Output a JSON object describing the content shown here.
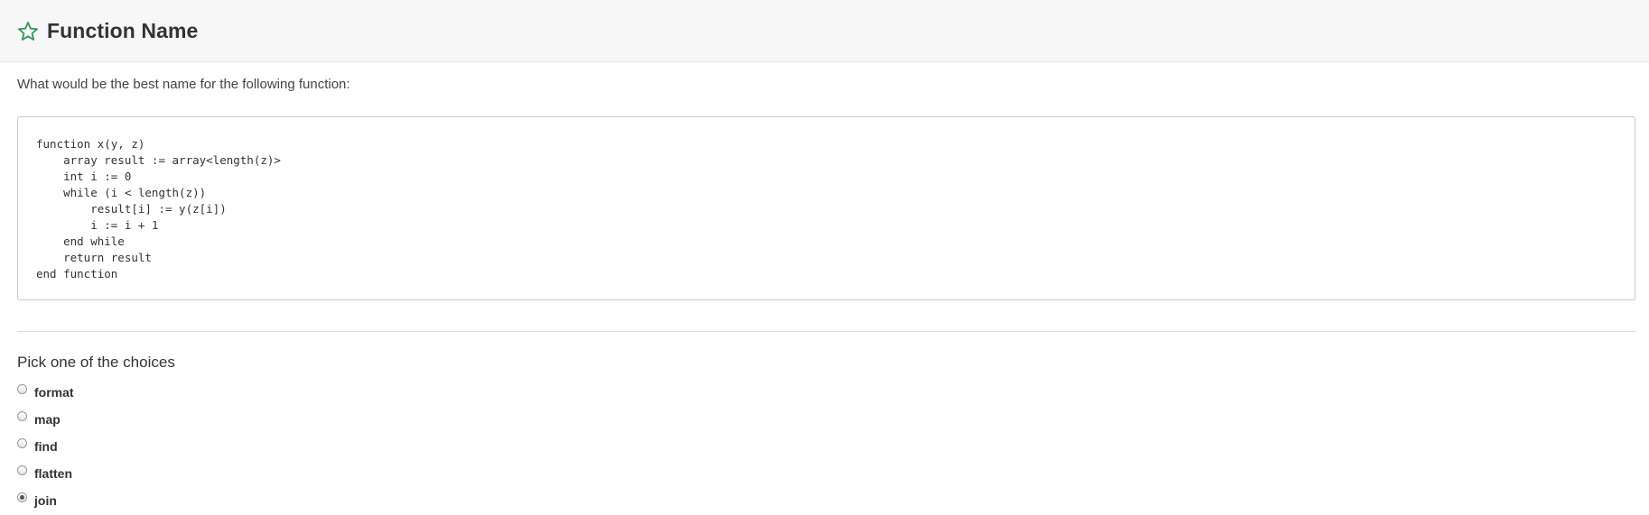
{
  "header": {
    "icon": "star-icon",
    "icon_color": "#2e9a5a",
    "title": "Function Name"
  },
  "question": {
    "text": "What would be the best name for the following function:"
  },
  "code": {
    "lines": [
      "function x(y, z)",
      "    array result := array<length(z)>",
      "    int i := 0",
      "    while (i < length(z))",
      "        result[i] := y(z[i])",
      "        i := i + 1",
      "    end while",
      "    return result",
      "end function"
    ]
  },
  "choices": {
    "heading": "Pick one of the choices",
    "selected": "join",
    "options": [
      {
        "label": "format"
      },
      {
        "label": "map"
      },
      {
        "label": "find"
      },
      {
        "label": "flatten"
      },
      {
        "label": "join"
      }
    ]
  }
}
